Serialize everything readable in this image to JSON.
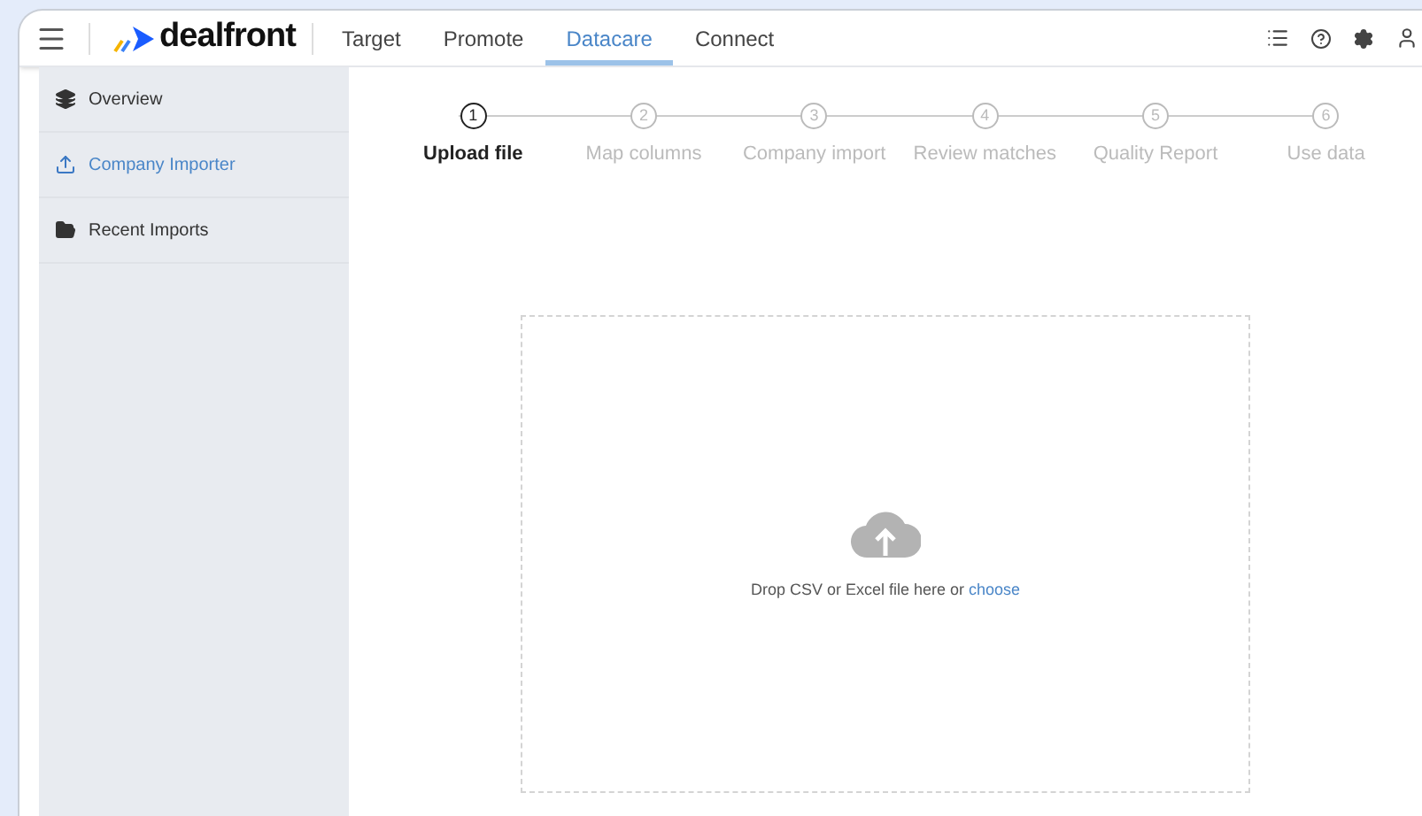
{
  "header": {
    "logo": "dealfront",
    "nav": [
      {
        "label": "Target",
        "selected": false
      },
      {
        "label": "Promote",
        "selected": false
      },
      {
        "label": "Datacare",
        "selected": true
      },
      {
        "label": "Connect",
        "selected": false
      }
    ]
  },
  "sidebar": {
    "items": [
      {
        "label": "Overview",
        "kind": "layers",
        "selected": false
      },
      {
        "label": "Company Importer",
        "kind": "upload",
        "selected": true
      },
      {
        "label": "Recent Imports",
        "kind": "folder",
        "selected": false
      }
    ]
  },
  "steps": [
    {
      "number": "1",
      "label": "Upload file",
      "selected": true
    },
    {
      "number": "2",
      "label": "Map columns",
      "selected": false
    },
    {
      "number": "3",
      "label": "Company import",
      "selected": false
    },
    {
      "number": "4",
      "label": "Review matches",
      "selected": false
    },
    {
      "number": "5",
      "label": "Quality Report",
      "selected": false
    },
    {
      "number": "6",
      "label": "Use data",
      "selected": false
    }
  ],
  "dropzone": {
    "text": "Drop CSV or Excel file here or",
    "link": "choose"
  }
}
